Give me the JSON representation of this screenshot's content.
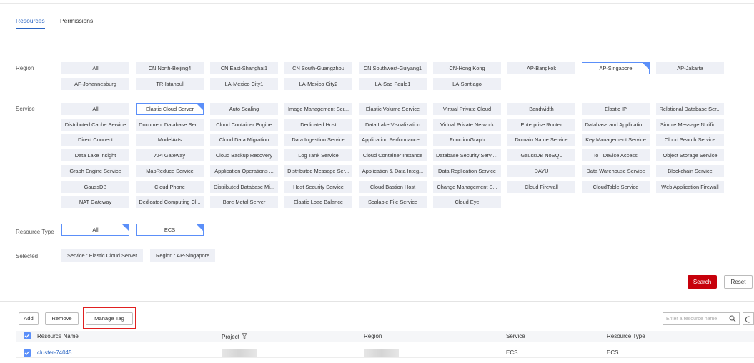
{
  "tabs": [
    {
      "label": "Resources",
      "active": true
    },
    {
      "label": "Permissions",
      "active": false
    }
  ],
  "labels": {
    "region": "Region",
    "service": "Service",
    "resource_type": "Resource Type",
    "selected": "Selected"
  },
  "regions": [
    "All",
    "CN North-Beijing4",
    "CN East-Shanghai1",
    "CN South-Guangzhou",
    "CN Southwest-Guiyang1",
    "CN-Hong Kong",
    "AP-Bangkok",
    "AP-Singapore",
    "AP-Jakarta",
    "AF-Johannesburg",
    "TR-Istanbul",
    "LA-Mexico City1",
    "LA-Mexico City2",
    "LA-Sao Paulo1",
    "LA-Santiago"
  ],
  "selected_region": "AP-Singapore",
  "services": [
    "All",
    "Elastic Cloud Server",
    "Auto Scaling",
    "Image Management Ser...",
    "Elastic Volume Service",
    "Virtual Private Cloud",
    "Bandwidth",
    "Elastic IP",
    "Relational Database Ser...",
    "Distributed Cache Service",
    "Document Database Ser...",
    "Cloud Container Engine",
    "Dedicated Host",
    "Data Lake Visualization",
    "Virtual Private Network",
    "Enterprise Router",
    "Database and Applicatio...",
    "Simple Message Notific...",
    "Direct Connect",
    "ModelArts",
    "Cloud Data Migration",
    "Data Ingestion Service",
    "Application Performance...",
    "FunctionGraph",
    "Domain Name Service",
    "Key Management Service",
    "Cloud Search Service",
    "Data Lake Insight",
    "API Gateway",
    "Cloud Backup Recovery",
    "Log Tank Service",
    "Cloud Container Instance",
    "Database Security Service",
    "GaussDB NoSQL",
    "IoT Device Access",
    "Object Storage Service",
    "Graph Engine Service",
    "MapReduce Service",
    "Application Operations ...",
    "Distributed Message Ser...",
    "Application & Data Integ...",
    "Data Replication Service",
    "DAYU",
    "Data Warehouse Service",
    "Blockchain Service",
    "GaussDB",
    "Cloud Phone",
    "Distributed Database Mi...",
    "Host Security Service",
    "Cloud Bastion Host",
    "Change Management S...",
    "Cloud Firewall",
    "CloudTable Service",
    "Web Application Firewall",
    "NAT Gateway",
    "Dedicated Computing Cl...",
    "Bare Metal Server",
    "Elastic Load Balance",
    "Scalable File Service",
    "Cloud Eye"
  ],
  "selected_service": "Elastic Cloud Server",
  "resource_types": [
    "All",
    "ECS"
  ],
  "selected_resource_types": [
    "All",
    "ECS"
  ],
  "selected_tags": [
    "Service : Elastic Cloud Server",
    "Region : AP-Singapore"
  ],
  "buttons": {
    "search": "Search",
    "reset": "Reset",
    "add": "Add",
    "remove": "Remove",
    "manage_tag": "Manage Tag"
  },
  "search_input": {
    "placeholder": "Enter a resource name",
    "value": ""
  },
  "table": {
    "headers": [
      "Resource Name",
      "Project",
      "Region",
      "Service",
      "Resource Type"
    ],
    "rows": [
      {
        "name": "cluster-74045",
        "project": "",
        "region": "",
        "service": "ECS",
        "resource_type": "ECS",
        "checked": true
      }
    ]
  },
  "colors": {
    "accent": "#2a64c2",
    "chip_bg": "#eef0f6",
    "chip_selected_border": "#5b8ff9",
    "search_button": "#c7000b",
    "highlight_box": "#e02020"
  },
  "icons": {
    "search": "search-icon",
    "refresh": "refresh-icon",
    "filter": "filter-icon",
    "checkbox": "checkbox-checked-icon"
  }
}
